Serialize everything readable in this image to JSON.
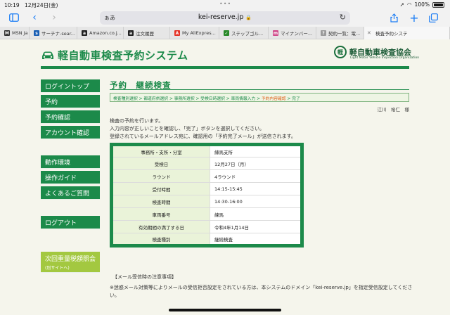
{
  "status": {
    "time": "10:19",
    "date": "12月24日(金)",
    "battery": "100%"
  },
  "browser": {
    "address_prefix": "ぁあ",
    "url": "kei-reserve.jp",
    "tabs": [
      {
        "label": "MSN Ja",
        "favicon": "M",
        "color": "#333333"
      },
      {
        "label": "サーチナ-sear...",
        "favicon": "s",
        "color": "#1a5fb4"
      },
      {
        "label": "Amazon.co.j...",
        "favicon": "a",
        "color": "#222222"
      },
      {
        "label": "注文履歴",
        "favicon": "a",
        "color": "#222222"
      },
      {
        "label": "My AliExpres...",
        "favicon": "A",
        "color": "#e43225"
      },
      {
        "label": "ステップゴル...",
        "favicon": "✓",
        "color": "#2a8a2a"
      },
      {
        "label": "マイナンバー...",
        "favicon": "m",
        "color": "#d04a8a"
      },
      {
        "label": "契約一覧：電...",
        "favicon": "?",
        "color": "#9a9a9a"
      },
      {
        "label": "検査予約システ",
        "favicon": "",
        "color": "#f7f7f7"
      }
    ]
  },
  "site": {
    "logo_text": "軽自動車検査予約システム",
    "assoc_name": "軽自動車検査協会",
    "assoc_en": "Light Motor Vehicle Inspection Organization"
  },
  "nav": {
    "login_top": "ログイントップ",
    "reserve": "予約",
    "confirm": "予約確認",
    "account": "アカウント確認",
    "env": "動作環境",
    "guide": "操作ガイド",
    "faq": "よくあるご質問",
    "logout": "ログアウト",
    "weight_tax": "次回重量税額照会",
    "weight_tax_sub": "(別サイトへ)"
  },
  "main": {
    "title": "予約　継続検査",
    "breadcrumb_before": "検査種別選択 > 都道府県選択 > 事務所選択 > 受検日時選択 > 車両情報入力 > ",
    "breadcrumb_current": "予約内容確認",
    "breadcrumb_after": " > 完了",
    "username": "江川　裕仁　様",
    "intro1": "検査の予約を行います。",
    "intro2": "入力内容が正しいことを確認し、「完了」ボタンを選択してください。",
    "intro3": "登録されているメールアドレス宛に、確認用の「予約完了メール」が送信されます。"
  },
  "table": {
    "rows": [
      {
        "label": "事務所・支所・分室",
        "value": "練馬支所"
      },
      {
        "label": "受検日",
        "value": "12月27日（月）"
      },
      {
        "label": "ラウンド",
        "value": "4ラウンド"
      },
      {
        "label": "受付時間",
        "value": "14:15-15:45"
      },
      {
        "label": "検査時間",
        "value": "14:30-16:00"
      },
      {
        "label": "車両番号",
        "value": "練馬"
      },
      {
        "label": "有効期間の満了する日",
        "value": "令和4年1月14日"
      },
      {
        "label": "検査種別",
        "value": "継続検査"
      }
    ]
  },
  "notice": {
    "title": "【メール受信時の注意事項】",
    "body": "※迷惑メール対策等によりメールの受信拒否設定をされている方は、本システムのドメイン「kei-reserve.jp」を指定受信設定してください。"
  }
}
